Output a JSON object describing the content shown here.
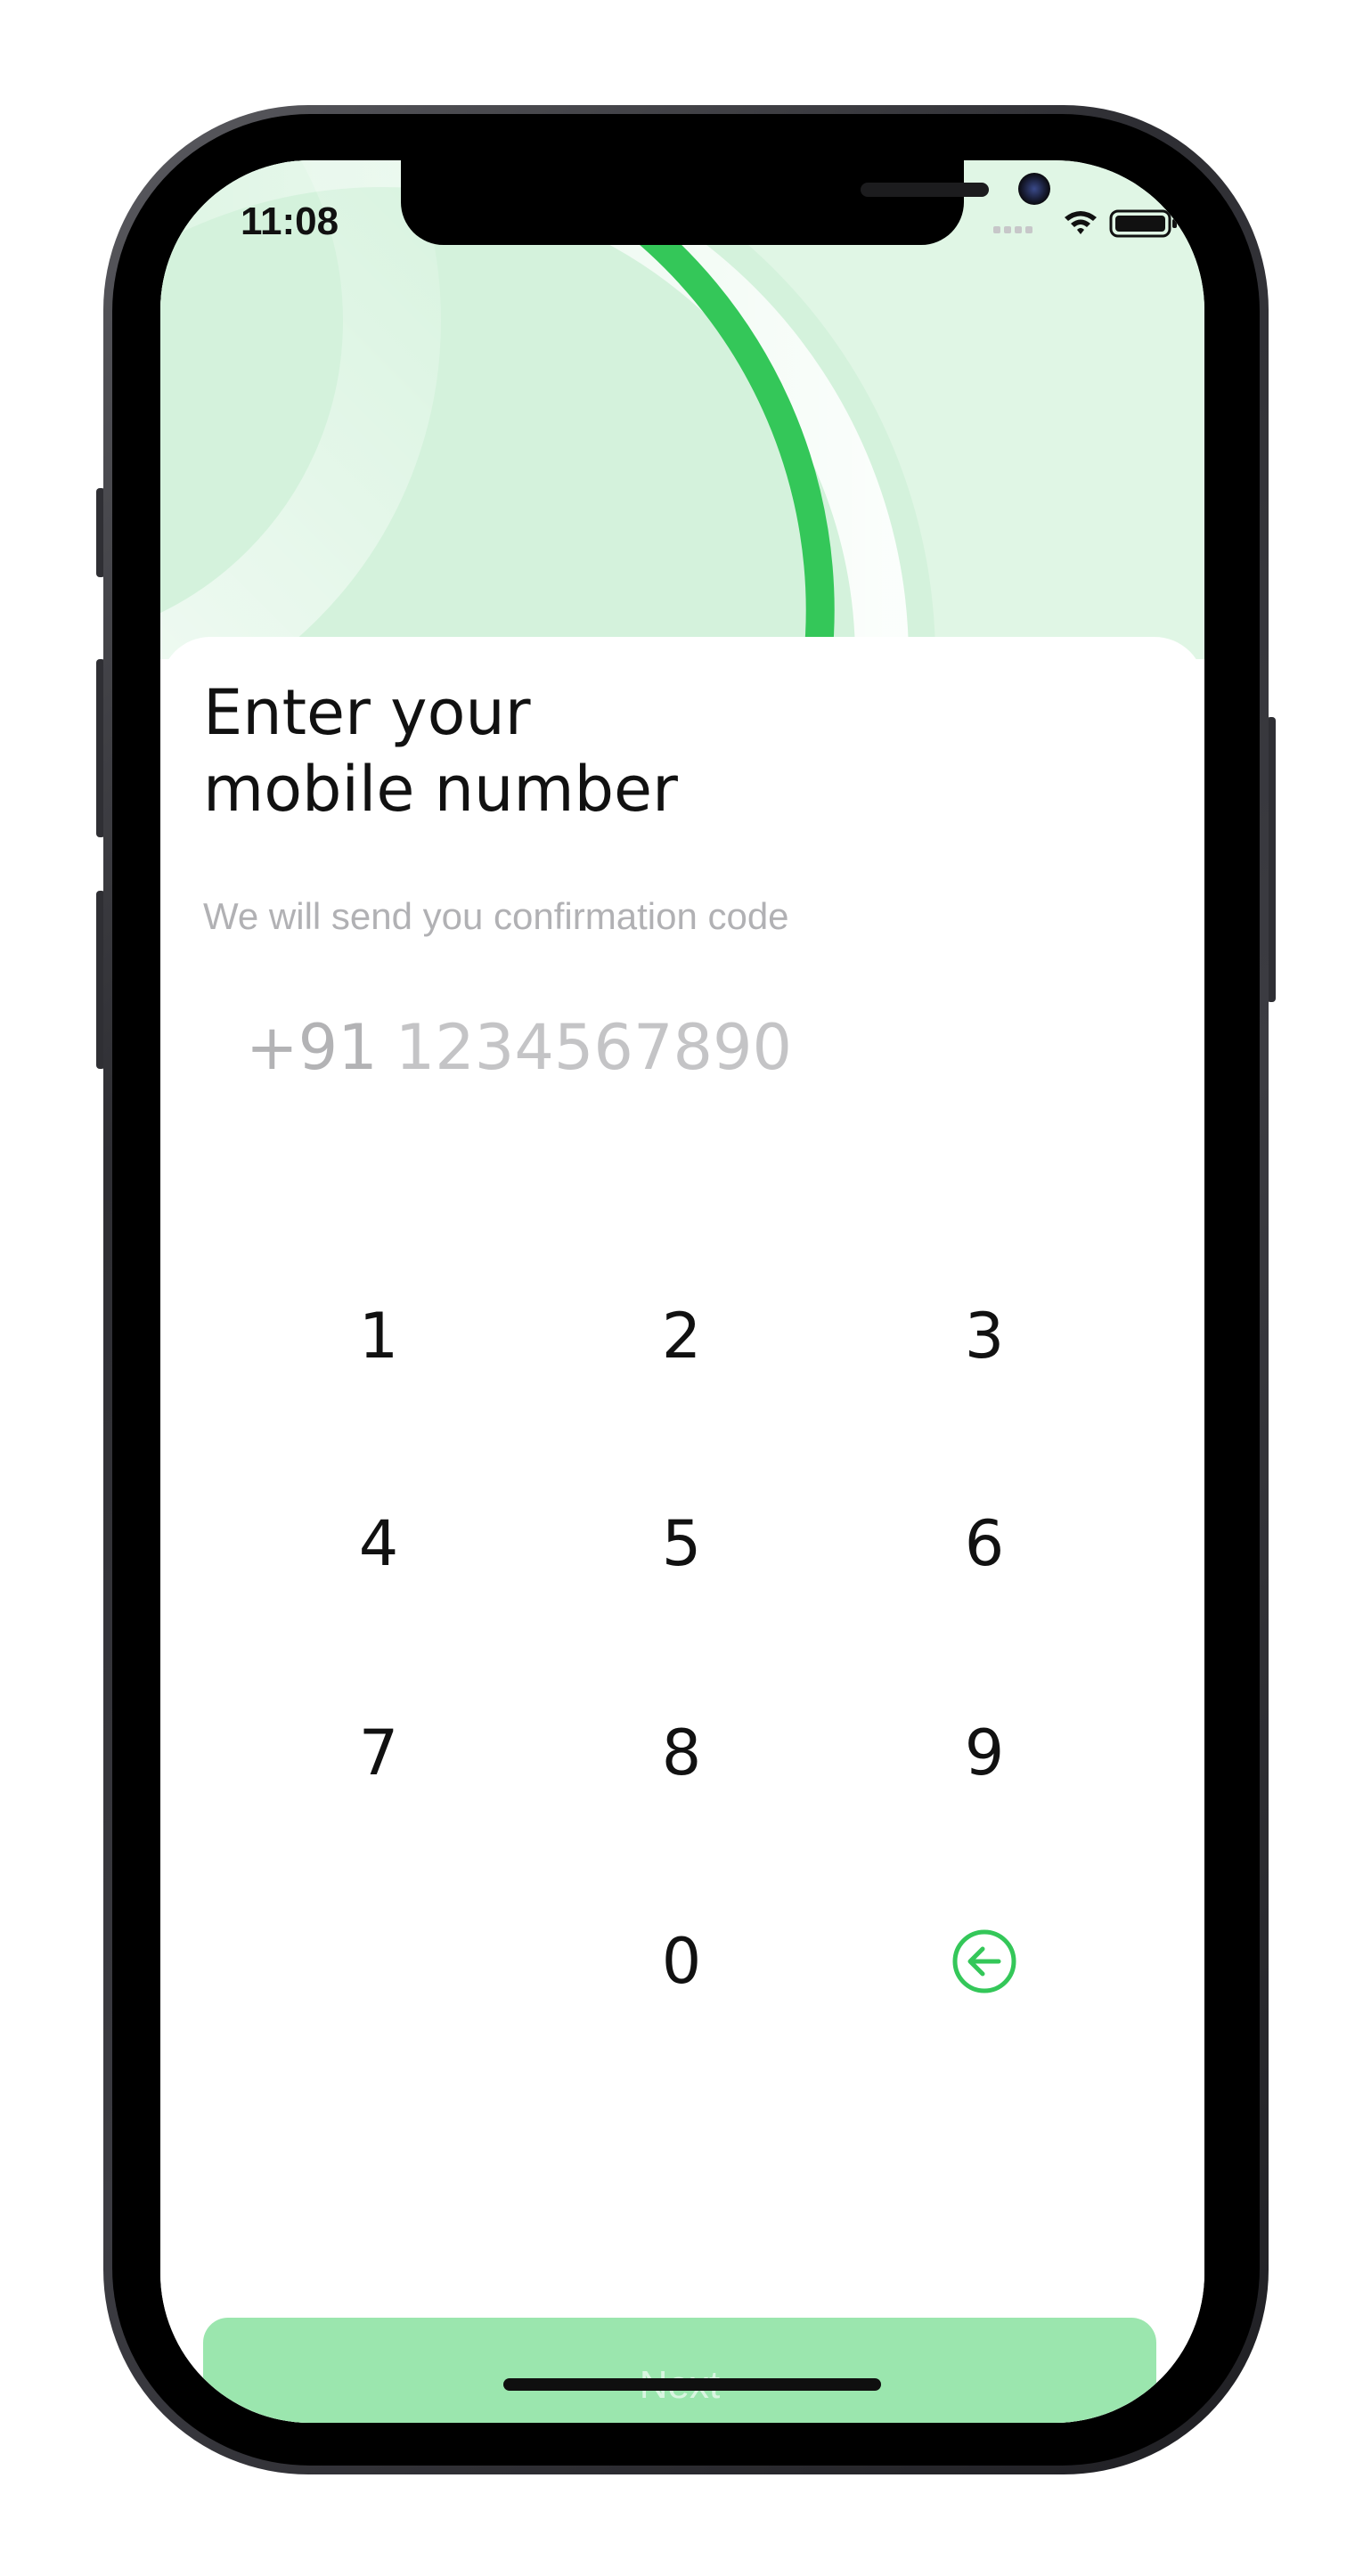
{
  "status_bar": {
    "time": "11:08",
    "icons": [
      "signal-icon",
      "wifi-icon",
      "battery-icon"
    ]
  },
  "header": {
    "title": "Enter your\nmobile number",
    "subtitle": "We will send you confirmation code"
  },
  "phone_field": {
    "country_code": "+91",
    "placeholder": "1234567890"
  },
  "keypad": {
    "keys": [
      "1",
      "2",
      "3",
      "4",
      "5",
      "6",
      "7",
      "8",
      "9",
      "0"
    ],
    "backspace_icon": "backspace-arrow-left-icon"
  },
  "actions": {
    "next_label": "Next"
  },
  "colors": {
    "accent": "#34c759",
    "hero_background": "#e0f6e5",
    "button_disabled": "#9be6ae"
  }
}
